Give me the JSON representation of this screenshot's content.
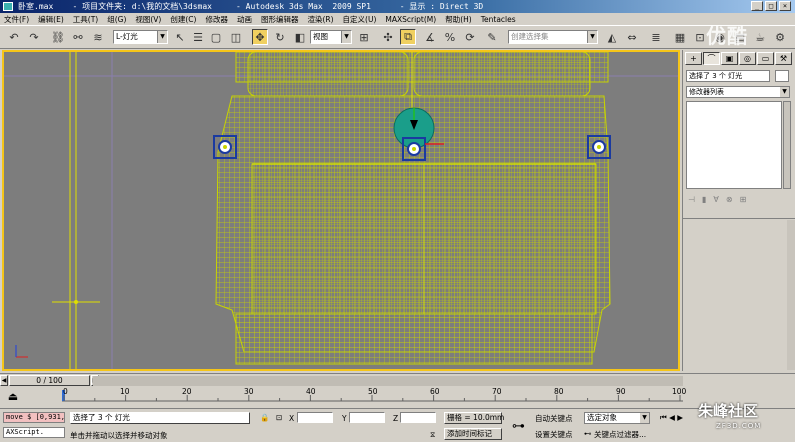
{
  "titlebar": {
    "title": "卧室.max    - 项目文件夹: d:\\我的文档\\3dsmax     - Autodesk 3ds Max  2009 SP1      - 显示 : Direct 3D"
  },
  "menu": [
    "文件(F)",
    "编辑(E)",
    "工具(T)",
    "组(G)",
    "视图(V)",
    "创建(C)",
    "修改器",
    "动画",
    "图形编辑器",
    "渲染(R)",
    "自定义(U)",
    "MAXScript(M)",
    "帮助(H)",
    "Tentacles"
  ],
  "toolbar": {
    "selection_filter": "L-灯光",
    "reference_coord": "视图",
    "named_selection": "创建选择集"
  },
  "viewport": {
    "label": ""
  },
  "command_panel": {
    "tabs": [
      "+",
      "⌒",
      "▣",
      "◎",
      "▭",
      "⚒"
    ],
    "selection_name": "选择了 3 个 灯光",
    "modifier_list": "修改器列表"
  },
  "time_slider": {
    "frame_label": "0 / 100"
  },
  "track_bar": {
    "ticks": [
      "0",
      "10",
      "20",
      "30",
      "40",
      "50",
      "60",
      "70",
      "80",
      "90",
      "100"
    ]
  },
  "status": {
    "maxscript_top": "move $ [0,931,",
    "maxscript_bottom": "AXScript.",
    "selected_text": "选择了 3 个 灯光",
    "prompt_text": "单击并拖动以选择并移动对象",
    "x_label": "X",
    "y_label": "Y",
    "z_label": "Z",
    "grid_text": "栅格 = 10.0mm",
    "add_time_tag": "添加时间标记",
    "auto_key": "自动关键点",
    "set_key": "设置关键点",
    "selected_object": "选定对象",
    "key_filters": "关键点过滤器..."
  },
  "watermarks": {
    "top": "优酷",
    "bottom": "朱峰社区",
    "bottom_url": "ZF3D.COM"
  },
  "colors": {
    "wireframe": "#c8d400",
    "viewport_bg": "#7d7d7d",
    "active_border": "#f5c518",
    "light_icon": "#1a3aa0"
  }
}
